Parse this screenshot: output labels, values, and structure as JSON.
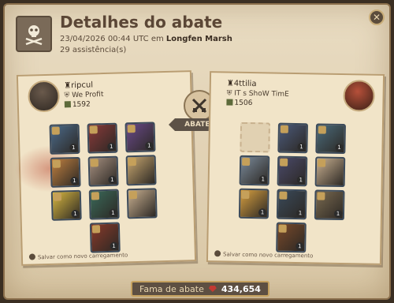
{
  "header": {
    "title": "Detalhes do abate",
    "datetime": "23/04/2026 00:44 UTC",
    "location_prefix": "em",
    "location": "Longfen Marsh",
    "assists": "29 assistência(s)"
  },
  "killer": {
    "name": "ripcul",
    "guild": "We Profit",
    "item_power": "1592",
    "save_label": "Salvar como novo carregamento"
  },
  "victim": {
    "name": "4ttilia",
    "guild": "IT s ShoW TimE",
    "item_power": "1506",
    "save_label": "Salvar como novo carregamento"
  },
  "killed_label": "ABATEU",
  "fame": {
    "label": "Fama de abate",
    "value": "434,654"
  },
  "killer_slots": [
    {
      "q": "1",
      "color": "#4b6a8a"
    },
    {
      "q": "1",
      "color": "#8a3a3a"
    },
    {
      "q": "1",
      "color": "#6a4a8a"
    },
    {
      "q": "1",
      "color": "#c08040"
    },
    {
      "q": "1",
      "color": "#a69080"
    },
    {
      "q": "",
      "color": "#c9a870"
    },
    {
      "q": "1",
      "color": "#d8b840"
    },
    {
      "q": "1",
      "color": "#3a6a5a"
    },
    {
      "q": "",
      "color": "#c9b090"
    },
    {
      "q": "1",
      "color": "#8a3a2a"
    }
  ],
  "victim_slots": [
    {
      "q": "",
      "color": ""
    },
    {
      "q": "1",
      "color": "#4b5a7a"
    },
    {
      "q": "1",
      "color": "#4a6a7a"
    },
    {
      "q": "1",
      "color": "#7a8a9a"
    },
    {
      "q": "1",
      "color": "#4a4a6a"
    },
    {
      "q": "",
      "color": "#c9b090"
    },
    {
      "q": "1",
      "color": "#d8a040"
    },
    {
      "q": "1",
      "color": "#3a4a5a"
    },
    {
      "q": "1",
      "color": "#7a6a50"
    },
    {
      "q": "1",
      "color": "#7a4a2a"
    }
  ],
  "icons": {
    "title_icon": "skull-crossbones-icon",
    "close": "close-icon",
    "killed": "crossed-swords-icon",
    "fame": "fame-gem-icon"
  }
}
